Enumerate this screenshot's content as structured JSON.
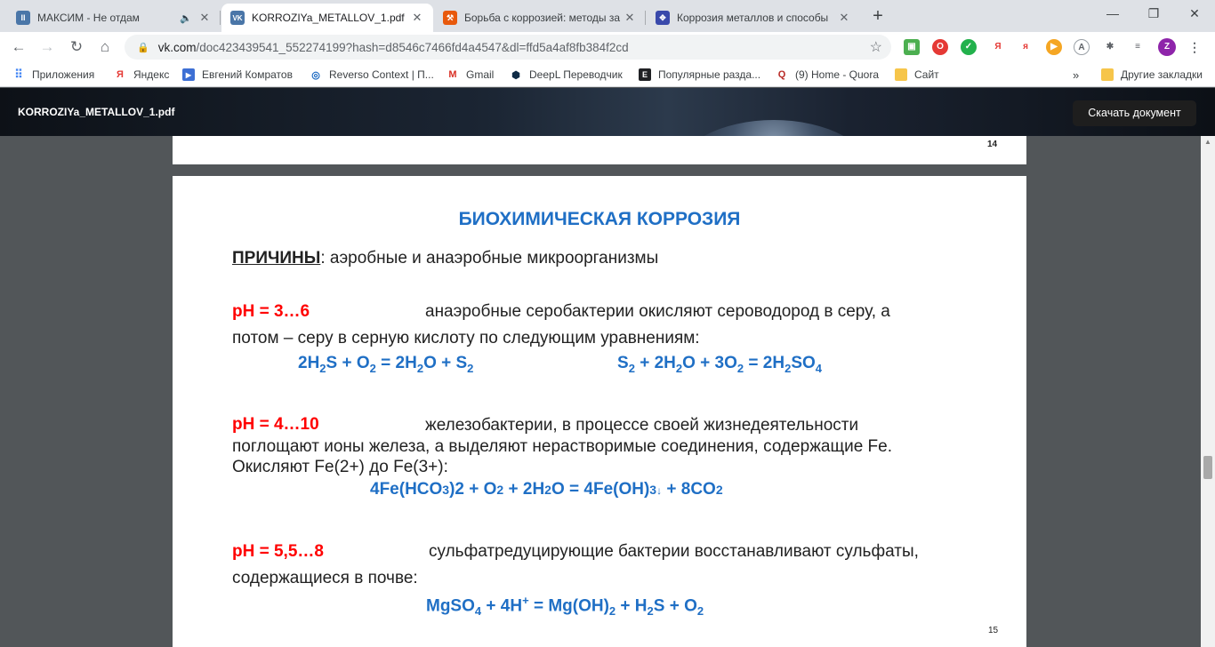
{
  "browser": {
    "tabs": [
      {
        "title": "МАКСИМ - Не отдам",
        "favicon": "pause-icon",
        "color": "#4a76a8",
        "glyph": "II"
      },
      {
        "title": "KORROZIYa_METALLOV_1.pdf",
        "favicon": "vk-icon",
        "color": "#4a76a8",
        "glyph": "VK"
      },
      {
        "title": "Борьба с коррозией: методы за",
        "favicon": "hammer-icon",
        "color": "#e8590c",
        "glyph": "⚒"
      },
      {
        "title": "Коррозия металлов и способы",
        "favicon": "compass-icon",
        "color": "#3949ab",
        "glyph": "✥"
      }
    ],
    "url_host": "vk.com",
    "url_path": "/doc423439541_552274199?hash=d8546c7466fd4a4547&dl=ffd5a4af8fb384f2cd"
  },
  "bookmarks": {
    "items": [
      "Приложения",
      "Яндекс",
      "Евгений Комратов",
      "Reverso Context | П...",
      "Gmail",
      "DeepL Переводчик",
      "Популярные разда...",
      "(9) Home - Quora",
      "Сайт"
    ],
    "more": "»",
    "other": "Другие закладки"
  },
  "viewer": {
    "doc_name": "KORROZIYa_METALLOV_1.pdf",
    "download_label": "Скачать документ",
    "page14_number": "14",
    "page15_number": "15"
  },
  "page": {
    "title": "БИОХИМИЧЕСКАЯ КОРРОЗИЯ",
    "reasons_label": "ПРИЧИНЫ",
    "reasons_text": ": аэробные и анаэробные микроорганизмы",
    "ph1": "pH = 3…6",
    "ph1_text1": "анаэробные серобактерии окисляют сероводород в серу, а",
    "ph1_text2": "потом – серу в серную кислоту по следующим уравнениям:",
    "ph2": "pH = 4…10",
    "ph2_text1": "железобактерии, в процессе своей жизнедеятельности",
    "ph2_text2": "поглощают ионы железа, а выделяют нерастворимые соединения, содержащие Fe.",
    "ph2_text3": "Окисляют Fe(2+) до Fe(3+):",
    "ph3": "pH = 5,5…8",
    "ph3_text1": "сульфатредуцирующие бактерии восстанавливают сульфаты,",
    "ph3_text2": "содержащиеся в почве:"
  },
  "colors": {
    "accent_blue": "#1f6fc5",
    "ph_red": "#ff0000"
  }
}
